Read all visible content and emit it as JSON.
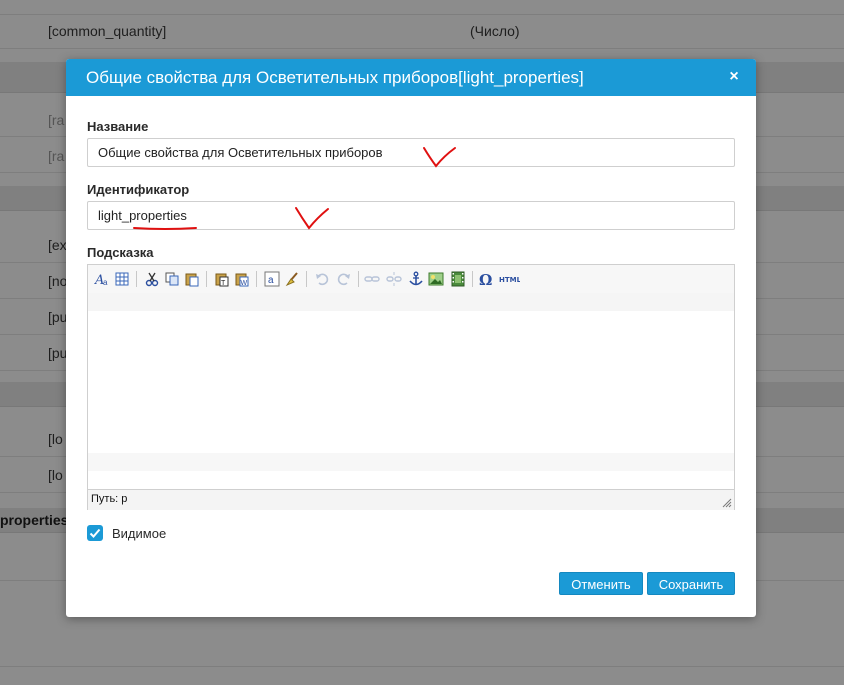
{
  "background": {
    "rows": [
      {
        "field": "[common_quantity]",
        "type": "(Число)"
      }
    ],
    "fragments": [
      "[ra",
      "[ra",
      "[ex",
      "[no",
      "[pu",
      "[pu",
      "[lo",
      "[lo"
    ],
    "left_bold_fragment": "properties"
  },
  "dialog": {
    "title": "Общие свойства для Осветительных приборов[light_properties]",
    "close_glyph": "×",
    "name_label": "Название",
    "name_value": "Общие свойства для Осветительных приборов",
    "id_label": "Идентификатор",
    "id_value": "light_properties",
    "hint_label": "Подсказка",
    "editor": {
      "path_label": "Путь: p",
      "toolbar": [
        "format-icon",
        "table-icon",
        "cut-icon",
        "copy-icon",
        "paste-icon",
        "paste-text-icon",
        "paste-word-icon",
        "spellcheck-icon",
        "clean-icon",
        "undo-icon",
        "redo-icon",
        "link-icon",
        "unlink-icon",
        "anchor-icon",
        "image-icon",
        "media-icon",
        "special-char-icon",
        "html-icon"
      ]
    },
    "visible_label": "Видимое",
    "visible_checked": true,
    "cancel_label": "Отменить",
    "save_label": "Сохранить"
  },
  "colors": {
    "accent": "#1b9ad6",
    "annotation": "#e01010"
  }
}
